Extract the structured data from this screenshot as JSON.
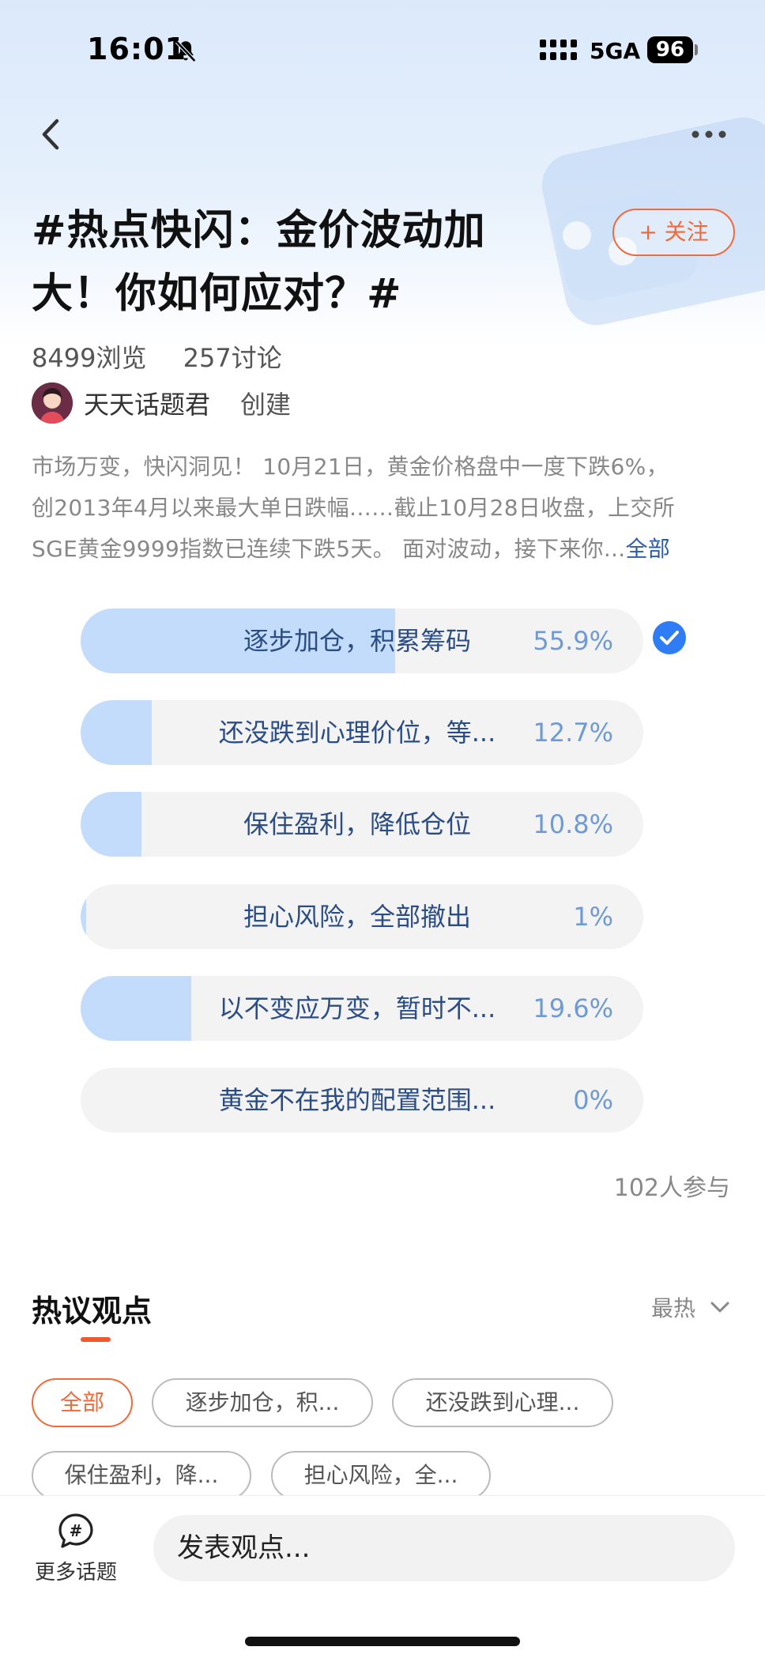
{
  "status_bar": {
    "time": "16:01",
    "network": "5GA",
    "battery": "96"
  },
  "topic": {
    "title": "#热点快闪：金价波动加大！你如何应对？#",
    "follow_label": "+ 关注",
    "views": "8499浏览",
    "discussions": "257讨论",
    "creator_name": "天天话题君",
    "creator_role": "创建",
    "description_lines": [
      "市场万变，快闪洞见！ 10月21日，黄金价格盘中一度下跌6%，",
      "创2013年4月以来最大单日跌幅……截止10月28日收盘，上交所",
      "SGE黄金9999指数已连续下跌5天。 面对波动，接下来你..."
    ],
    "description_more": "全部"
  },
  "poll": {
    "options": [
      {
        "label": "逐步加仓，积累筹码",
        "percent": "55.9%",
        "fraction": 0.559,
        "selected": true
      },
      {
        "label": "还没跌到心理价位，等...",
        "percent": "12.7%",
        "fraction": 0.127,
        "selected": false
      },
      {
        "label": "保住盈利，降低仓位",
        "percent": "10.8%",
        "fraction": 0.108,
        "selected": false
      },
      {
        "label": "担心风险，全部撤出",
        "percent": "1%",
        "fraction": 0.01,
        "selected": false
      },
      {
        "label": "以不变应万变，暂时不...",
        "percent": "19.6%",
        "fraction": 0.196,
        "selected": false
      },
      {
        "label": "黄金不在我的配置范围...",
        "percent": "0%",
        "fraction": 0.0,
        "selected": false
      }
    ],
    "participants": "102人参与"
  },
  "hot_section": {
    "title": "热议观点",
    "sort_label": "最热",
    "chips": [
      "全部",
      "逐步加仓，积...",
      "还没跌到心理...",
      "保住盈利，降...",
      "担心风险，全..."
    ]
  },
  "bottom_bar": {
    "more_topics": "更多话题",
    "comment_placeholder": "发表观点..."
  },
  "colors": {
    "accent_orange": "#f06a3b",
    "poll_fill": "#c4dcfb",
    "poll_text": "#2b4d86",
    "check_blue": "#2e7cf6"
  },
  "icons": [
    "bell-off-icon",
    "signal-icon",
    "back-arrow-icon",
    "more-dots-icon",
    "check-icon",
    "chevron-down-icon",
    "hashtag-icon"
  ]
}
